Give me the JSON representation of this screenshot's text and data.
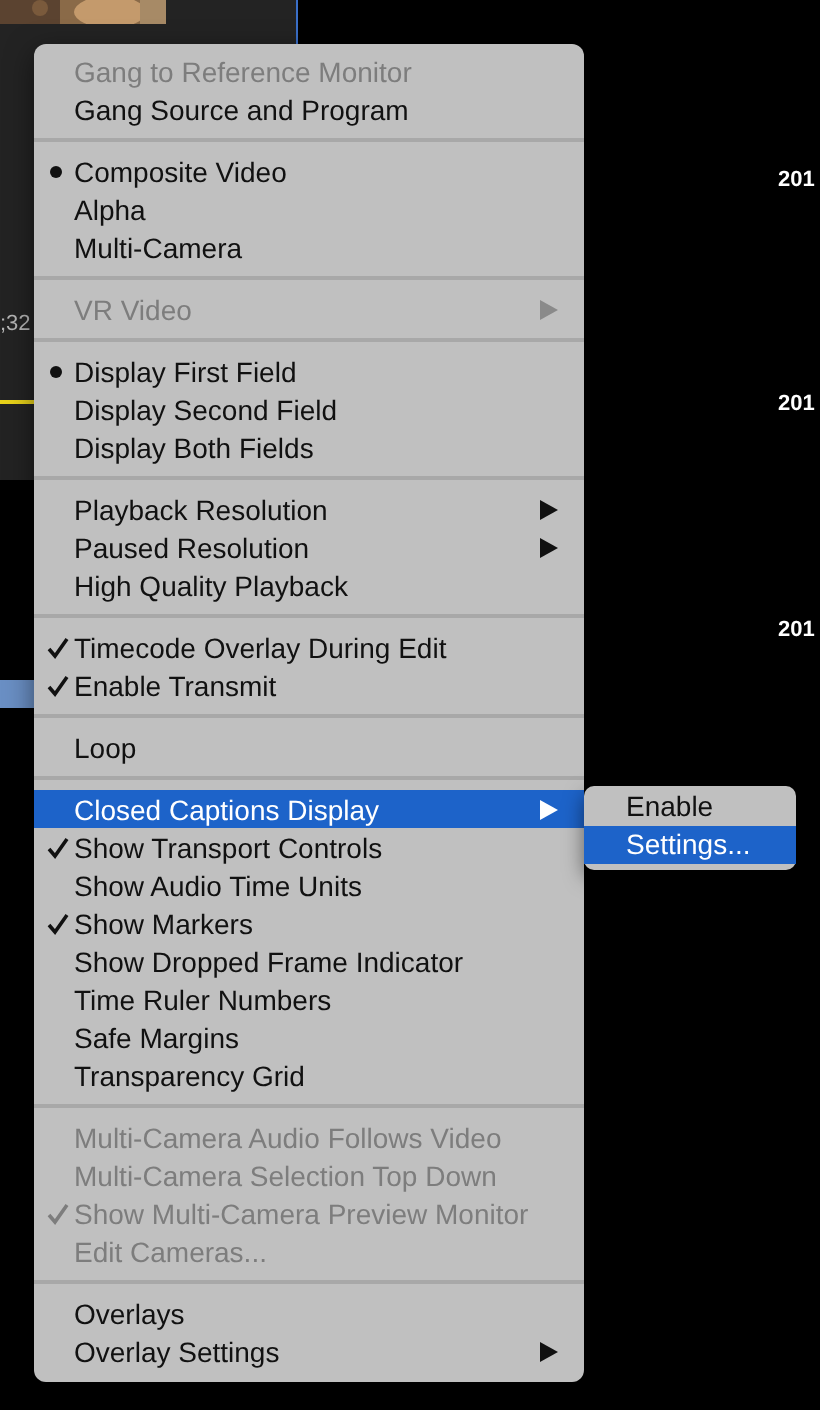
{
  "background": {
    "timecode_fragment": ";32",
    "dates": [
      "201",
      "201",
      "201"
    ]
  },
  "menu": {
    "sections": [
      [
        {
          "label": "Gang to Reference Monitor",
          "kind": "plain",
          "disabled": true,
          "submenu": false,
          "highlighted": false
        },
        {
          "label": "Gang Source and Program",
          "kind": "plain",
          "disabled": false,
          "submenu": false,
          "highlighted": false
        }
      ],
      [
        {
          "label": "Composite Video",
          "kind": "radio",
          "selected": true,
          "disabled": false,
          "submenu": false,
          "highlighted": false
        },
        {
          "label": "Alpha",
          "kind": "radio",
          "selected": false,
          "disabled": false,
          "submenu": false,
          "highlighted": false
        },
        {
          "label": "Multi-Camera",
          "kind": "radio",
          "selected": false,
          "disabled": false,
          "submenu": false,
          "highlighted": false
        }
      ],
      [
        {
          "label": "VR Video",
          "kind": "plain",
          "disabled": true,
          "submenu": true,
          "highlighted": false
        }
      ],
      [
        {
          "label": "Display First Field",
          "kind": "radio",
          "selected": true,
          "disabled": false,
          "submenu": false,
          "highlighted": false
        },
        {
          "label": "Display Second Field",
          "kind": "radio",
          "selected": false,
          "disabled": false,
          "submenu": false,
          "highlighted": false
        },
        {
          "label": "Display Both Fields",
          "kind": "radio",
          "selected": false,
          "disabled": false,
          "submenu": false,
          "highlighted": false
        }
      ],
      [
        {
          "label": "Playback Resolution",
          "kind": "plain",
          "disabled": false,
          "submenu": true,
          "highlighted": false
        },
        {
          "label": "Paused Resolution",
          "kind": "plain",
          "disabled": false,
          "submenu": true,
          "highlighted": false
        },
        {
          "label": "High Quality Playback",
          "kind": "check",
          "checked": false,
          "disabled": false,
          "submenu": false,
          "highlighted": false
        }
      ],
      [
        {
          "label": "Timecode Overlay During Edit",
          "kind": "check",
          "checked": true,
          "disabled": false,
          "submenu": false,
          "highlighted": false
        },
        {
          "label": "Enable Transmit",
          "kind": "check",
          "checked": true,
          "disabled": false,
          "submenu": false,
          "highlighted": false
        }
      ],
      [
        {
          "label": "Loop",
          "kind": "check",
          "checked": false,
          "disabled": false,
          "submenu": false,
          "highlighted": false
        }
      ],
      [
        {
          "label": "Closed Captions Display",
          "kind": "plain",
          "disabled": false,
          "submenu": true,
          "highlighted": true
        },
        {
          "label": "Show Transport Controls",
          "kind": "check",
          "checked": true,
          "disabled": false,
          "submenu": false,
          "highlighted": false
        },
        {
          "label": "Show Audio Time Units",
          "kind": "check",
          "checked": false,
          "disabled": false,
          "submenu": false,
          "highlighted": false
        },
        {
          "label": "Show Markers",
          "kind": "check",
          "checked": true,
          "disabled": false,
          "submenu": false,
          "highlighted": false
        },
        {
          "label": "Show Dropped Frame Indicator",
          "kind": "check",
          "checked": false,
          "disabled": false,
          "submenu": false,
          "highlighted": false
        },
        {
          "label": "Time Ruler Numbers",
          "kind": "check",
          "checked": false,
          "disabled": false,
          "submenu": false,
          "highlighted": false
        },
        {
          "label": "Safe Margins",
          "kind": "check",
          "checked": false,
          "disabled": false,
          "submenu": false,
          "highlighted": false
        },
        {
          "label": "Transparency Grid",
          "kind": "check",
          "checked": false,
          "disabled": false,
          "submenu": false,
          "highlighted": false
        }
      ],
      [
        {
          "label": "Multi-Camera Audio Follows Video",
          "kind": "check",
          "checked": false,
          "disabled": true,
          "submenu": false,
          "highlighted": false
        },
        {
          "label": "Multi-Camera Selection Top Down",
          "kind": "check",
          "checked": false,
          "disabled": true,
          "submenu": false,
          "highlighted": false
        },
        {
          "label": "Show Multi-Camera Preview Monitor",
          "kind": "check",
          "checked": true,
          "disabled": true,
          "submenu": false,
          "highlighted": false
        },
        {
          "label": "Edit Cameras...",
          "kind": "plain",
          "disabled": true,
          "submenu": false,
          "highlighted": false
        }
      ],
      [
        {
          "label": "Overlays",
          "kind": "check",
          "checked": false,
          "disabled": false,
          "submenu": false,
          "highlighted": false
        },
        {
          "label": "Overlay Settings",
          "kind": "plain",
          "disabled": false,
          "submenu": true,
          "highlighted": false
        }
      ]
    ]
  },
  "submenu": {
    "items": [
      {
        "label": "Enable",
        "highlighted": false
      },
      {
        "label": "Settings...",
        "highlighted": true
      }
    ]
  }
}
